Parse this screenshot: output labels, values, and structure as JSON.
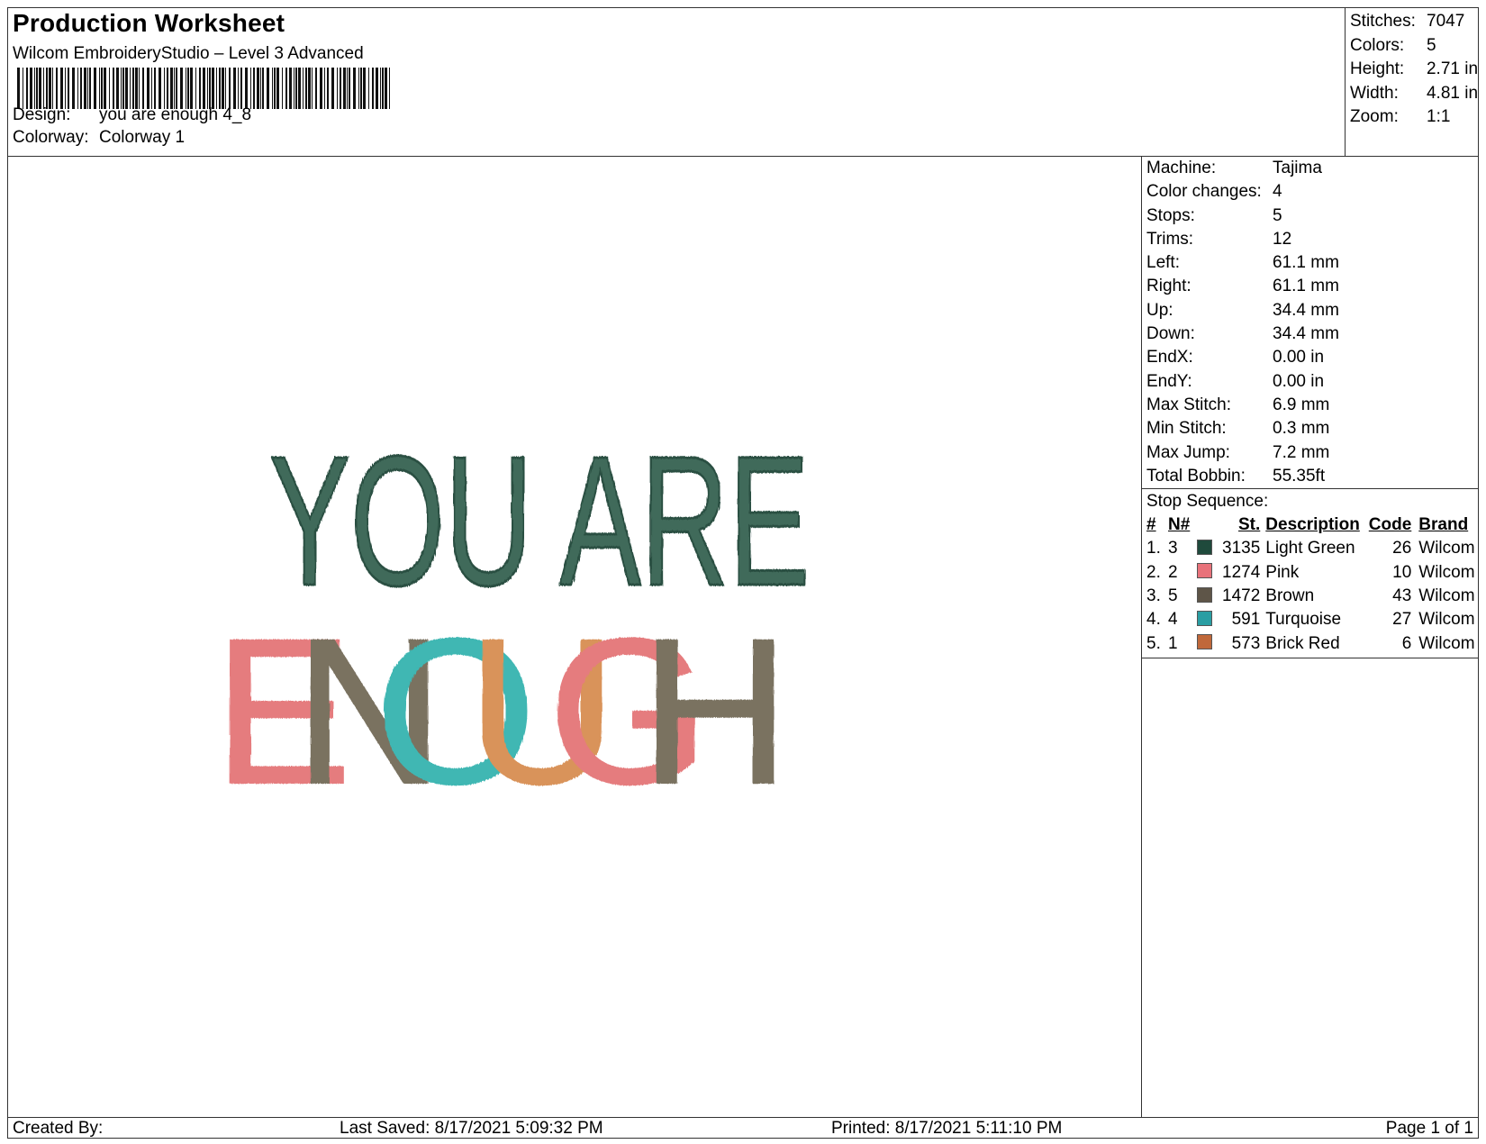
{
  "header": {
    "title": "Production Worksheet",
    "subtitle": "Wilcom EmbroideryStudio – Level 3 Advanced",
    "design_label": "Design:",
    "design_value": "you are enough 4_8",
    "colorway_label": "Colorway:",
    "colorway_value": "Colorway 1"
  },
  "summary": [
    {
      "label": "Stitches:",
      "value": "7047"
    },
    {
      "label": "Colors:",
      "value": "5"
    },
    {
      "label": "Height:",
      "value": "2.71 in"
    },
    {
      "label": "Width:",
      "value": "4.81 in"
    },
    {
      "label": "Zoom:",
      "value": "1:1"
    }
  ],
  "design_text": {
    "line1": "YOU ARE",
    "line2": [
      "E",
      "N",
      "O",
      "U",
      "G",
      "H"
    ],
    "line1_color": "#3f6b5a",
    "line2_colors": [
      "#e57c7e",
      "#7a7260",
      "#3fb7b3",
      "#d9935a",
      "#e57c7e",
      "#7a7260"
    ]
  },
  "params": [
    {
      "label": "Machine:",
      "value": "Tajima"
    },
    {
      "label": "Color changes:",
      "value": "4"
    },
    {
      "label": "Stops:",
      "value": "5"
    },
    {
      "label": "Trims:",
      "value": "12"
    },
    {
      "label": "Left:",
      "value": "61.1 mm"
    },
    {
      "label": "Right:",
      "value": "61.1 mm"
    },
    {
      "label": "Up:",
      "value": "34.4 mm"
    },
    {
      "label": "Down:",
      "value": "34.4 mm"
    },
    {
      "label": "EndX:",
      "value": "0.00 in"
    },
    {
      "label": "EndY:",
      "value": "0.00 in"
    },
    {
      "label": "Max Stitch:",
      "value": "6.9 mm"
    },
    {
      "label": "Min Stitch:",
      "value": "0.3 mm"
    },
    {
      "label": "Max Jump:",
      "value": "7.2 mm"
    },
    {
      "label": "Total Bobbin:",
      "value": "55.35ft"
    }
  ],
  "stop_sequence": {
    "title": "Stop Sequence:",
    "headers": {
      "num": "#",
      "n": "N#",
      "st": "St.",
      "desc": "Description",
      "code": "Code",
      "brand": "Brand"
    },
    "rows": [
      {
        "num": "1.",
        "n": "3",
        "color": "#1f4a3c",
        "st": "3135",
        "desc": "Light Green",
        "code": "26",
        "brand": "Wilcom"
      },
      {
        "num": "2.",
        "n": "2",
        "color": "#e8727a",
        "st": "1274",
        "desc": "Pink",
        "code": "10",
        "brand": "Wilcom"
      },
      {
        "num": "3.",
        "n": "5",
        "color": "#5e5548",
        "st": "1472",
        "desc": "Brown",
        "code": "43",
        "brand": "Wilcom"
      },
      {
        "num": "4.",
        "n": "4",
        "color": "#2a9ea3",
        "st": "591",
        "desc": "Turquoise",
        "code": "27",
        "brand": "Wilcom"
      },
      {
        "num": "5.",
        "n": "1",
        "color": "#c0683a",
        "st": "573",
        "desc": "Brick Red",
        "code": "6",
        "brand": "Wilcom"
      }
    ]
  },
  "footer": {
    "created_by": "Created By:",
    "last_saved": "Last Saved: 8/17/2021 5:09:32 PM",
    "printed": "Printed: 8/17/2021 5:11:10 PM",
    "page": "Page 1 of 1"
  }
}
